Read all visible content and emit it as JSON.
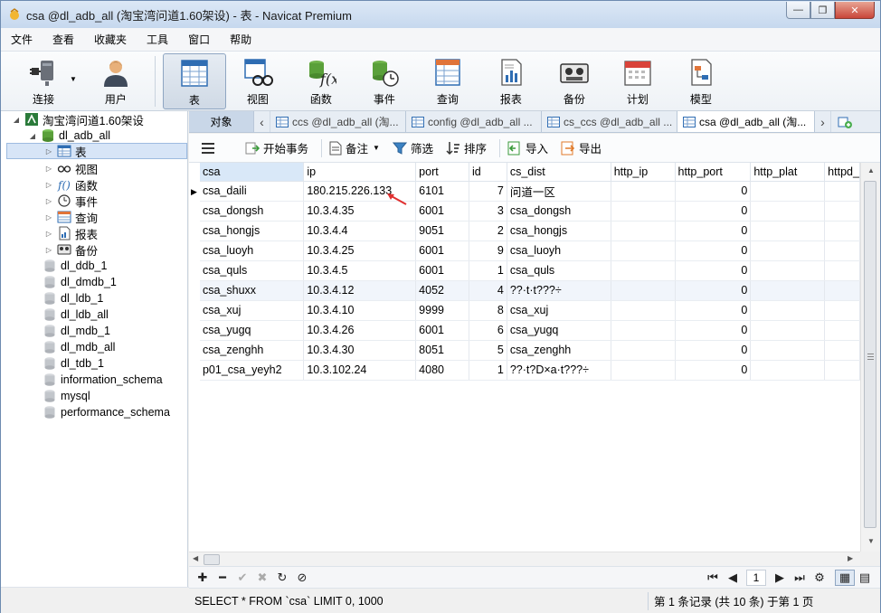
{
  "window": {
    "title": "csa @dl_adb_all (淘宝湾问道1.60架设) - 表 - Navicat Premium"
  },
  "menu": [
    "文件",
    "查看",
    "收藏夹",
    "工具",
    "窗口",
    "帮助"
  ],
  "toolbar": {
    "connect": "连接",
    "user": "用户",
    "table": "表",
    "view": "视图",
    "function": "函数",
    "event": "事件",
    "query": "查询",
    "report": "报表",
    "backup": "备份",
    "schedule": "计划",
    "model": "模型"
  },
  "sidebar": {
    "connection": "淘宝湾问道1.60架设",
    "database": "dl_adb_all",
    "children": [
      "表",
      "视图",
      "函数",
      "事件",
      "查询",
      "报表",
      "备份"
    ],
    "other_databases": [
      "dl_ddb_1",
      "dl_dmdb_1",
      "dl_ldb_1",
      "dl_ldb_all",
      "dl_mdb_1",
      "dl_mdb_all",
      "dl_tdb_1",
      "information_schema",
      "mysql",
      "performance_schema"
    ]
  },
  "tabs": {
    "objects": "对象",
    "items": [
      "ccs @dl_adb_all (淘...",
      "config @dl_adb_all ...",
      "cs_ccs @dl_adb_all ...",
      "csa @dl_adb_all (淘..."
    ]
  },
  "edit_toolbar": {
    "begin_transaction": "开始事务",
    "memo": "备注",
    "filter": "筛选",
    "sort": "排序",
    "import": "导入",
    "export": "导出"
  },
  "grid": {
    "columns": [
      "csa",
      "ip",
      "port",
      "id",
      "cs_dist",
      "http_ip",
      "http_port",
      "http_plat",
      "httpd_"
    ],
    "rows": [
      [
        "csa_daili",
        "180.215.226.133",
        "6101",
        "7",
        "问道一区",
        "",
        "0",
        "",
        ""
      ],
      [
        "csa_dongsh",
        "10.3.4.35",
        "6001",
        "3",
        "csa_dongsh",
        "",
        "0",
        "",
        ""
      ],
      [
        "csa_hongjs",
        "10.3.4.4",
        "9051",
        "2",
        "csa_hongjs",
        "",
        "0",
        "",
        ""
      ],
      [
        "csa_luoyh",
        "10.3.4.25",
        "6001",
        "9",
        "csa_luoyh",
        "",
        "0",
        "",
        ""
      ],
      [
        "csa_quls",
        "10.3.4.5",
        "6001",
        "1",
        "csa_quls",
        "",
        "0",
        "",
        ""
      ],
      [
        "csa_shuxx",
        "10.3.4.12",
        "4052",
        "4",
        "??·t·t???÷",
        "",
        "0",
        "",
        ""
      ],
      [
        "csa_xuj",
        "10.3.4.10",
        "9999",
        "8",
        "csa_xuj",
        "",
        "0",
        "",
        ""
      ],
      [
        "csa_yugq",
        "10.3.4.26",
        "6001",
        "6",
        "csa_yugq",
        "",
        "0",
        "",
        ""
      ],
      [
        "csa_zenghh",
        "10.3.4.30",
        "8051",
        "5",
        "csa_zenghh",
        "",
        "0",
        "",
        ""
      ],
      [
        "p01_csa_yeyh2",
        "10.3.102.24",
        "4080",
        "1",
        "??·t?D×a·t???÷",
        "",
        "0",
        "",
        ""
      ]
    ]
  },
  "navigation": {
    "page": "1"
  },
  "status": {
    "sql": "SELECT * FROM `csa` LIMIT 0, 1000",
    "records": "第 1 条记录 (共 10 条) 于第 1 页"
  },
  "colors": {
    "accent": "#d9e8f8",
    "arrow": "#e03030"
  }
}
